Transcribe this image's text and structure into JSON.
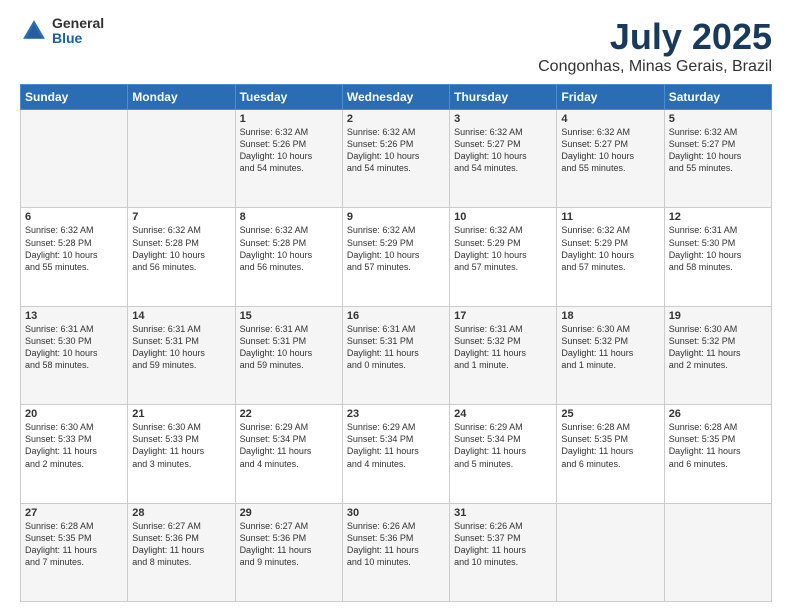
{
  "header": {
    "logo_general": "General",
    "logo_blue": "Blue",
    "month": "July 2025",
    "location": "Congonhas, Minas Gerais, Brazil"
  },
  "weekdays": [
    "Sunday",
    "Monday",
    "Tuesday",
    "Wednesday",
    "Thursday",
    "Friday",
    "Saturday"
  ],
  "weeks": [
    [
      {
        "day": "",
        "info": ""
      },
      {
        "day": "",
        "info": ""
      },
      {
        "day": "1",
        "info": "Sunrise: 6:32 AM\nSunset: 5:26 PM\nDaylight: 10 hours\nand 54 minutes."
      },
      {
        "day": "2",
        "info": "Sunrise: 6:32 AM\nSunset: 5:26 PM\nDaylight: 10 hours\nand 54 minutes."
      },
      {
        "day": "3",
        "info": "Sunrise: 6:32 AM\nSunset: 5:27 PM\nDaylight: 10 hours\nand 54 minutes."
      },
      {
        "day": "4",
        "info": "Sunrise: 6:32 AM\nSunset: 5:27 PM\nDaylight: 10 hours\nand 55 minutes."
      },
      {
        "day": "5",
        "info": "Sunrise: 6:32 AM\nSunset: 5:27 PM\nDaylight: 10 hours\nand 55 minutes."
      }
    ],
    [
      {
        "day": "6",
        "info": "Sunrise: 6:32 AM\nSunset: 5:28 PM\nDaylight: 10 hours\nand 55 minutes."
      },
      {
        "day": "7",
        "info": "Sunrise: 6:32 AM\nSunset: 5:28 PM\nDaylight: 10 hours\nand 56 minutes."
      },
      {
        "day": "8",
        "info": "Sunrise: 6:32 AM\nSunset: 5:28 PM\nDaylight: 10 hours\nand 56 minutes."
      },
      {
        "day": "9",
        "info": "Sunrise: 6:32 AM\nSunset: 5:29 PM\nDaylight: 10 hours\nand 57 minutes."
      },
      {
        "day": "10",
        "info": "Sunrise: 6:32 AM\nSunset: 5:29 PM\nDaylight: 10 hours\nand 57 minutes."
      },
      {
        "day": "11",
        "info": "Sunrise: 6:32 AM\nSunset: 5:29 PM\nDaylight: 10 hours\nand 57 minutes."
      },
      {
        "day": "12",
        "info": "Sunrise: 6:31 AM\nSunset: 5:30 PM\nDaylight: 10 hours\nand 58 minutes."
      }
    ],
    [
      {
        "day": "13",
        "info": "Sunrise: 6:31 AM\nSunset: 5:30 PM\nDaylight: 10 hours\nand 58 minutes."
      },
      {
        "day": "14",
        "info": "Sunrise: 6:31 AM\nSunset: 5:31 PM\nDaylight: 10 hours\nand 59 minutes."
      },
      {
        "day": "15",
        "info": "Sunrise: 6:31 AM\nSunset: 5:31 PM\nDaylight: 10 hours\nand 59 minutes."
      },
      {
        "day": "16",
        "info": "Sunrise: 6:31 AM\nSunset: 5:31 PM\nDaylight: 11 hours\nand 0 minutes."
      },
      {
        "day": "17",
        "info": "Sunrise: 6:31 AM\nSunset: 5:32 PM\nDaylight: 11 hours\nand 1 minute."
      },
      {
        "day": "18",
        "info": "Sunrise: 6:30 AM\nSunset: 5:32 PM\nDaylight: 11 hours\nand 1 minute."
      },
      {
        "day": "19",
        "info": "Sunrise: 6:30 AM\nSunset: 5:32 PM\nDaylight: 11 hours\nand 2 minutes."
      }
    ],
    [
      {
        "day": "20",
        "info": "Sunrise: 6:30 AM\nSunset: 5:33 PM\nDaylight: 11 hours\nand 2 minutes."
      },
      {
        "day": "21",
        "info": "Sunrise: 6:30 AM\nSunset: 5:33 PM\nDaylight: 11 hours\nand 3 minutes."
      },
      {
        "day": "22",
        "info": "Sunrise: 6:29 AM\nSunset: 5:34 PM\nDaylight: 11 hours\nand 4 minutes."
      },
      {
        "day": "23",
        "info": "Sunrise: 6:29 AM\nSunset: 5:34 PM\nDaylight: 11 hours\nand 4 minutes."
      },
      {
        "day": "24",
        "info": "Sunrise: 6:29 AM\nSunset: 5:34 PM\nDaylight: 11 hours\nand 5 minutes."
      },
      {
        "day": "25",
        "info": "Sunrise: 6:28 AM\nSunset: 5:35 PM\nDaylight: 11 hours\nand 6 minutes."
      },
      {
        "day": "26",
        "info": "Sunrise: 6:28 AM\nSunset: 5:35 PM\nDaylight: 11 hours\nand 6 minutes."
      }
    ],
    [
      {
        "day": "27",
        "info": "Sunrise: 6:28 AM\nSunset: 5:35 PM\nDaylight: 11 hours\nand 7 minutes."
      },
      {
        "day": "28",
        "info": "Sunrise: 6:27 AM\nSunset: 5:36 PM\nDaylight: 11 hours\nand 8 minutes."
      },
      {
        "day": "29",
        "info": "Sunrise: 6:27 AM\nSunset: 5:36 PM\nDaylight: 11 hours\nand 9 minutes."
      },
      {
        "day": "30",
        "info": "Sunrise: 6:26 AM\nSunset: 5:36 PM\nDaylight: 11 hours\nand 10 minutes."
      },
      {
        "day": "31",
        "info": "Sunrise: 6:26 AM\nSunset: 5:37 PM\nDaylight: 11 hours\nand 10 minutes."
      },
      {
        "day": "",
        "info": ""
      },
      {
        "day": "",
        "info": ""
      }
    ]
  ]
}
